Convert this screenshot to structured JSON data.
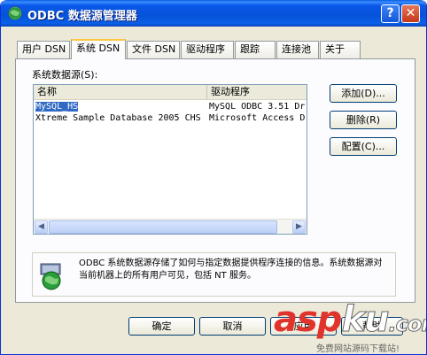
{
  "window": {
    "title": "ODBC 数据源管理器",
    "help_label": "?",
    "close_label": "✕"
  },
  "tabs": [
    {
      "label": "用户 DSN",
      "active": false
    },
    {
      "label": "系统 DSN",
      "active": true
    },
    {
      "label": "文件 DSN",
      "active": false
    },
    {
      "label": "驱动程序",
      "active": false
    },
    {
      "label": "跟踪",
      "active": false
    },
    {
      "label": "连接池",
      "active": false
    },
    {
      "label": "关于",
      "active": false
    }
  ],
  "list": {
    "section_label": "系统数据源(S):",
    "columns": [
      "名称",
      "驱动程序"
    ],
    "rows": [
      {
        "name": "MySQL_HS",
        "driver": "MySQL ODBC 3.51 Dr",
        "selected": true
      },
      {
        "name": "Xtreme Sample Database 2005 CHS",
        "driver": "Microsoft Access D",
        "selected": false
      }
    ]
  },
  "side_buttons": {
    "add": "添加(D)...",
    "remove": "删除(R)",
    "configure": "配置(C)..."
  },
  "info": {
    "text": "ODBC 系统数据源存储了如何与指定数据提供程序连接的信息。系统数据源对当前机器上的所有用户可见，包括 NT 服务。"
  },
  "bottom_buttons": {
    "ok": "确定",
    "cancel": "取消",
    "apply": "应用",
    "help": "帮助"
  },
  "watermark": {
    "brand_a": "asp",
    "brand_b": "ku",
    "brand_c": ".com",
    "sub": "免费网站源码下载站!"
  },
  "colors": {
    "titlebar": "#0553d8",
    "selection": "#316ac5",
    "active_tab_highlight": "#ffc83c",
    "watermark_red": "#e0332c"
  }
}
